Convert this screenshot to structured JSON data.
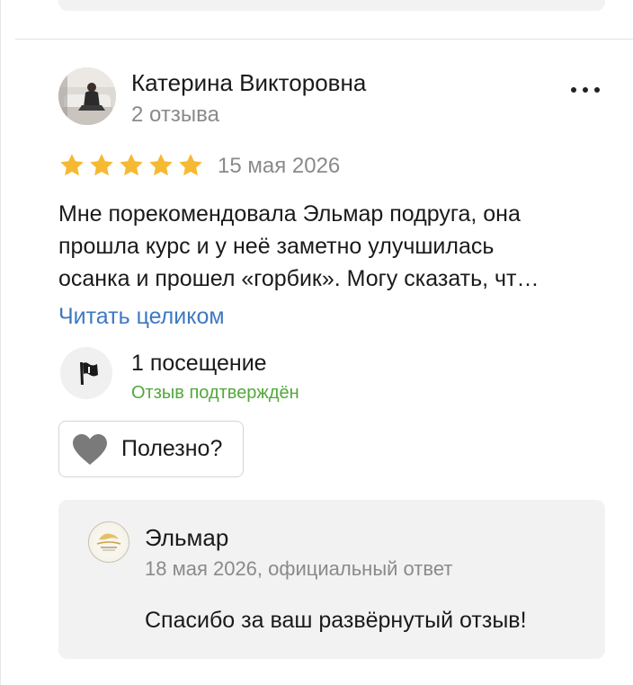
{
  "review": {
    "author": {
      "name": "Катерина Викторовна",
      "reviews_count": "2 отзыва"
    },
    "rating": 5,
    "rating_max": 5,
    "date": "15 мая 2026",
    "text_lines": [
      "Мне порекомендовала Эльмар подруга, она",
      "прошла курс и у неё заметно улучшилась",
      "осанка и прошел «горбик». Могу сказать, чт…"
    ],
    "read_more": "Читать целиком",
    "visits": "1 посещение",
    "verified": "Отзыв подтверждён",
    "useful_label": "Полезно?"
  },
  "reply": {
    "org_name": "Эльмар",
    "meta": "18 мая 2026, официальный ответ",
    "text": "Спасибо за ваш развёрнутый отзыв!"
  },
  "colors": {
    "star": "#f6b932",
    "link": "#3e78c2",
    "verified": "#52a83b",
    "muted": "#8a8a8a",
    "card_bg": "#f2f2f2"
  },
  "icons": {
    "more": "three-dots-icon",
    "visit": "flag-icon",
    "useful": "heart-icon"
  }
}
